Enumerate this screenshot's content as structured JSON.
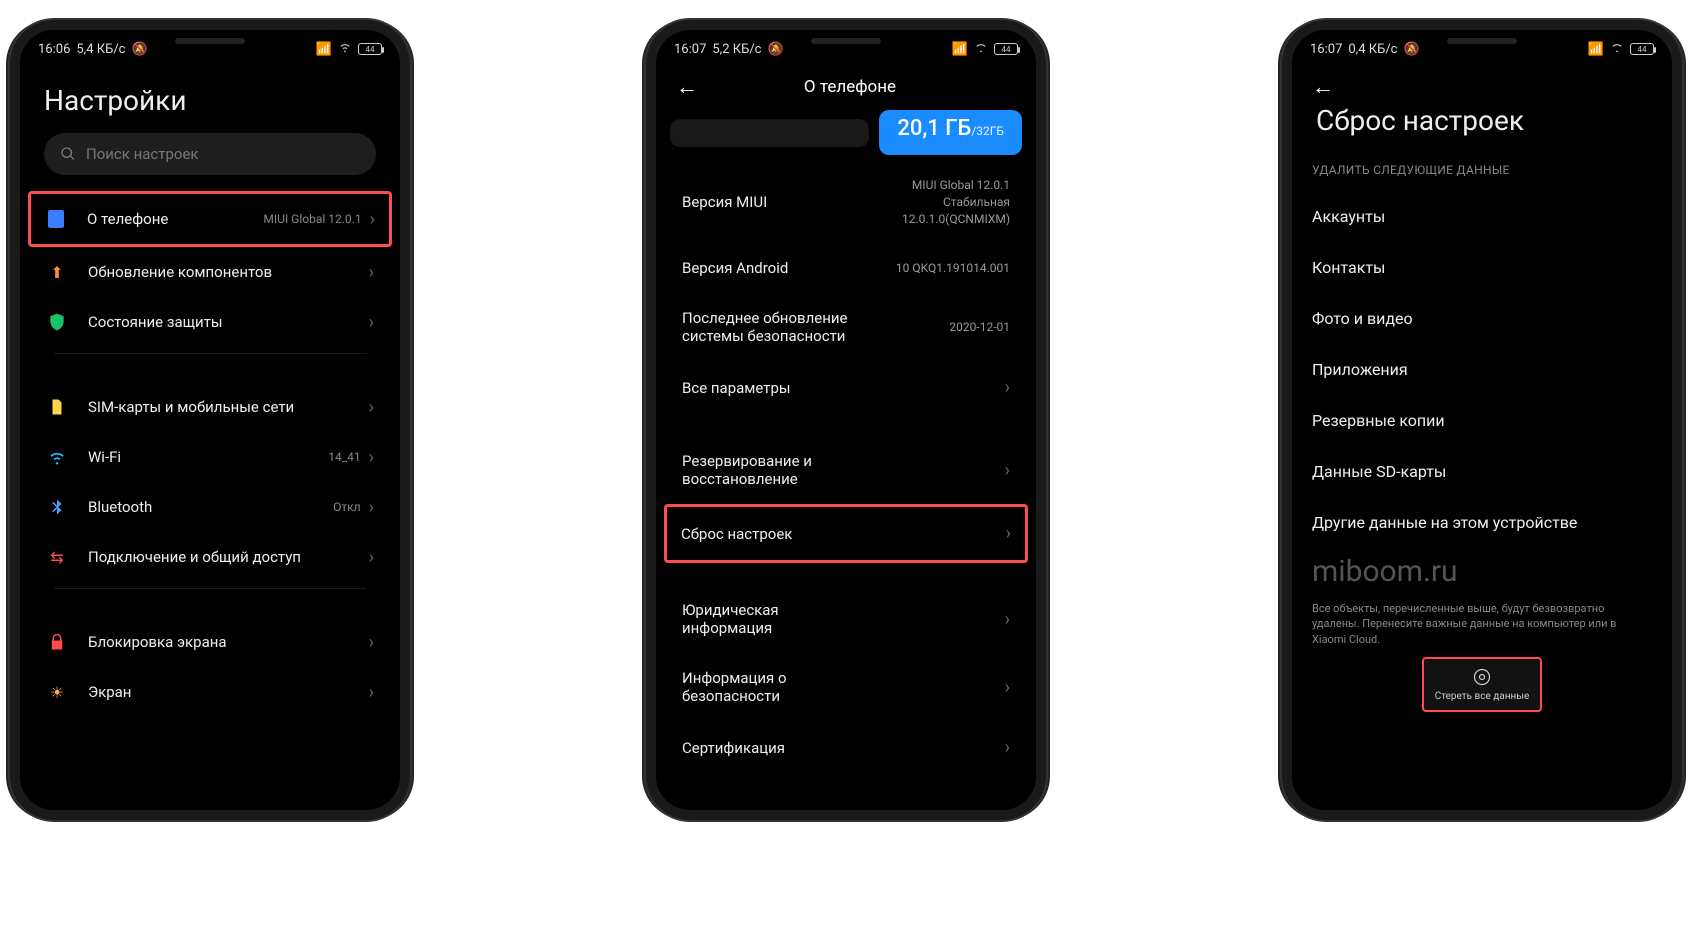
{
  "phone1": {
    "status": {
      "time": "16:06",
      "speed": "5,4 КБ/с",
      "battery": "44"
    },
    "title": "Настройки",
    "search_placeholder": "Поиск настроек",
    "rows": {
      "about": {
        "label": "О телефоне",
        "value": "MIUI Global 12.0.1"
      },
      "updates": {
        "label": "Обновление компонентов"
      },
      "security": {
        "label": "Состояние защиты"
      },
      "sim": {
        "label": "SIM-карты и мобильные сети"
      },
      "wifi": {
        "label": "Wi-Fi",
        "value": "14_41"
      },
      "bluetooth": {
        "label": "Bluetooth",
        "value": "Откл"
      },
      "share": {
        "label": "Подключение и общий доступ"
      },
      "lock": {
        "label": "Блокировка экрана"
      },
      "display": {
        "label": "Экран"
      }
    }
  },
  "phone2": {
    "status": {
      "time": "16:07",
      "speed": "5,2 КБ/с",
      "battery": "44"
    },
    "title": "О телефоне",
    "storage": {
      "used": "20,1 ГБ",
      "total": "/32ГБ"
    },
    "rows": {
      "miui": {
        "label": "Версия MIUI",
        "value": "MIUI Global 12.0.1\nСтабильная\n12.0.1.0(QCNMIXM)"
      },
      "android": {
        "label": "Версия Android",
        "value": "10 QKQ1.191014.001"
      },
      "patch": {
        "label": "Последнее обновление системы безопасности",
        "value": "2020-12-01"
      },
      "allspecs": {
        "label": "Все параметры"
      },
      "backup": {
        "label": "Резервирование и восстановление"
      },
      "reset": {
        "label": "Сброс настроек"
      },
      "legal": {
        "label": "Юридическая информация"
      },
      "safety": {
        "label": "Информация о безопасности"
      },
      "cert": {
        "label": "Сертификация"
      }
    }
  },
  "phone3": {
    "status": {
      "time": "16:07",
      "speed": "0,4 КБ/с",
      "battery": "44"
    },
    "title": "Сброс настроек",
    "subheader": "УДАЛИТЬ СЛЕДУЮЩИЕ ДАННЫЕ",
    "items": {
      "accounts": "Аккаунты",
      "contacts": "Контакты",
      "photos": "Фото и видео",
      "apps": "Приложения",
      "backups": "Резервные копии",
      "sd": "Данные SD-карты",
      "other": "Другие данные на этом устройстве"
    },
    "watermark": "miboom.ru",
    "disclaimer": "Все объекты, перечисленные выше, будут безвозвратно удалены. Перенесите важные данные на компьютер или в Xiaomi Cloud.",
    "erase_label": "Стереть все данные"
  }
}
